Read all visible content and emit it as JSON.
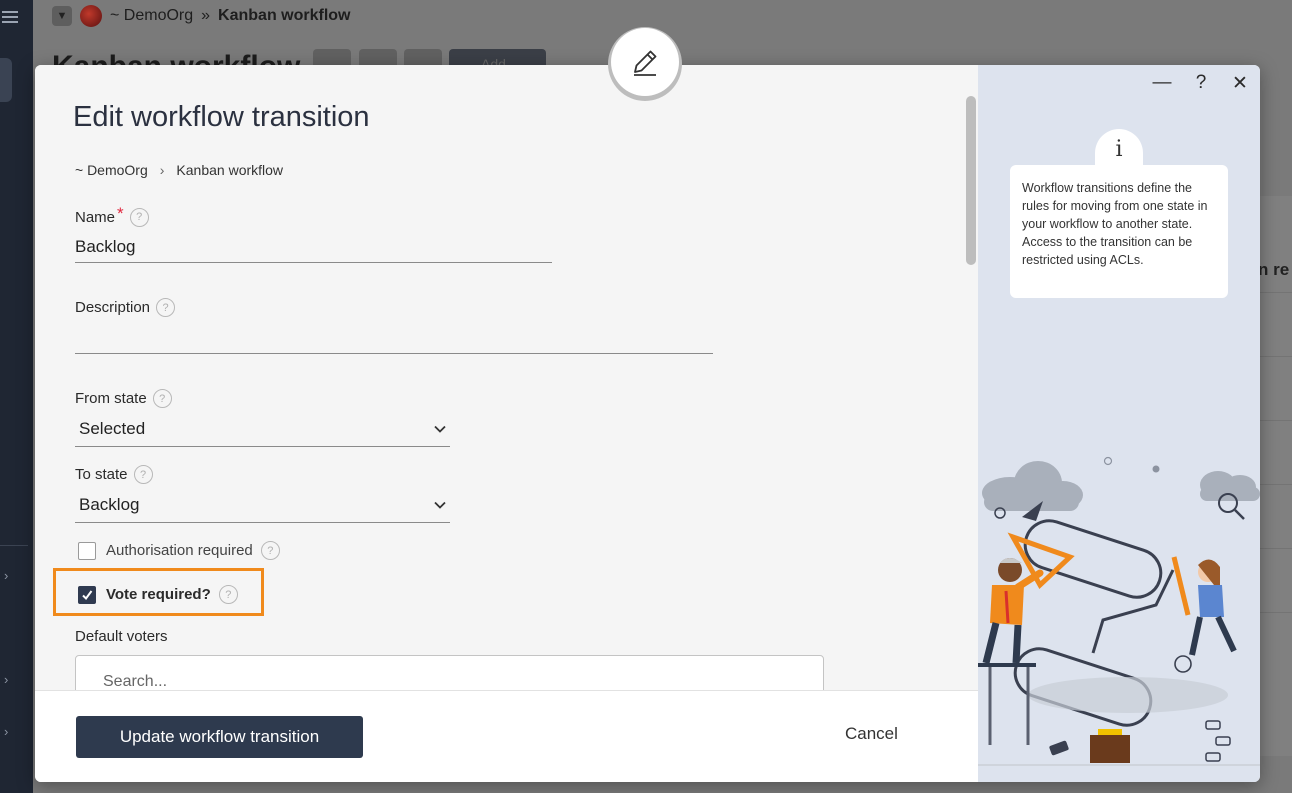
{
  "background": {
    "breadcrumb": {
      "org": "~ DemoOrg",
      "separator": "»",
      "page": "Kanban workflow"
    },
    "title": "Kanban workflow",
    "add_button": "Add",
    "side_text": "n re"
  },
  "modal": {
    "title": "Edit workflow transition",
    "breadcrumb": {
      "org": "~ DemoOrg",
      "separator": "›",
      "page": "Kanban workflow"
    },
    "fields": {
      "name": {
        "label": "Name",
        "required_mark": "*",
        "value": "Backlog"
      },
      "description": {
        "label": "Description",
        "value": ""
      },
      "from_state": {
        "label": "From state",
        "value": "Selected"
      },
      "to_state": {
        "label": "To state",
        "value": "Backlog"
      },
      "authorisation_required": {
        "label": "Authorisation required",
        "checked": false
      },
      "vote_required": {
        "label": "Vote required?",
        "checked": true
      },
      "default_voters": {
        "label": "Default voters",
        "placeholder": "Search..."
      }
    },
    "footer": {
      "submit_label": "Update workflow transition",
      "cancel_label": "Cancel"
    },
    "info": {
      "icon_glyph": "i",
      "text": "Workflow transitions define the rules for moving from one state in your workflow to another state. Access to the transition can be restricted using ACLs."
    },
    "window_controls": {
      "minimize": "—",
      "help": "?",
      "close": "✕"
    }
  },
  "colors": {
    "primary": "#2e3a4e",
    "highlight": "#f08a1c",
    "required": "#e0263d",
    "info_panel": "#dde3ee"
  }
}
